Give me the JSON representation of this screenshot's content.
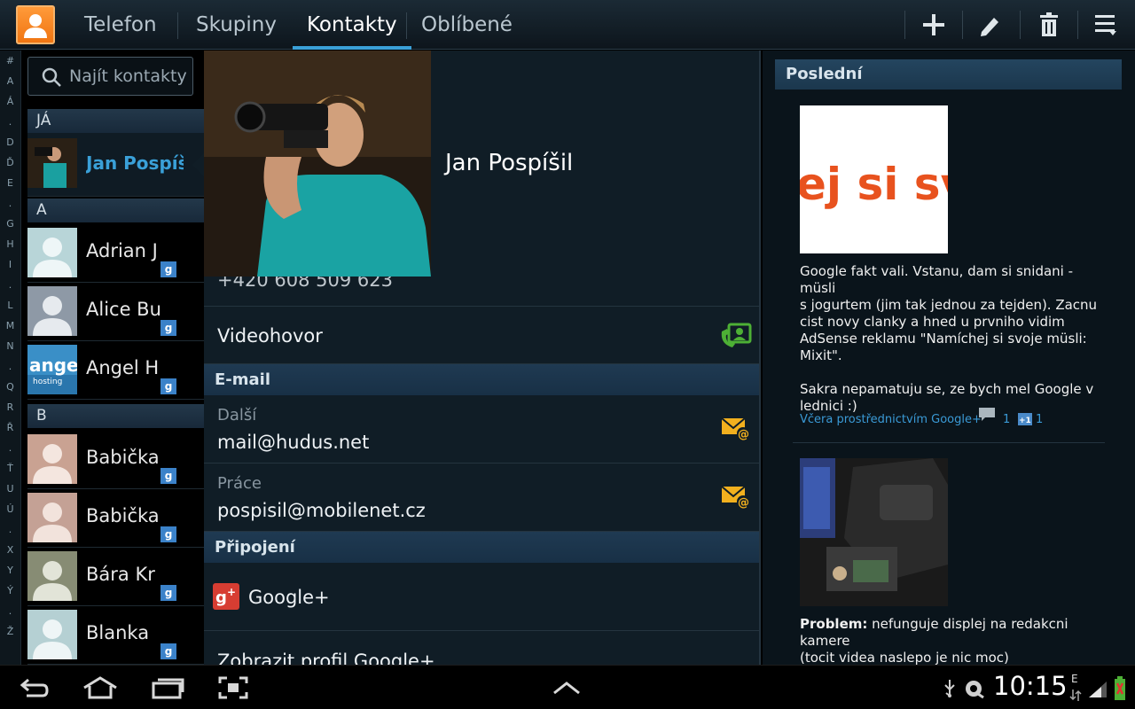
{
  "topbar": {
    "tabs": [
      "Telefon",
      "Skupiny",
      "Kontakty",
      "Oblíbené"
    ],
    "active_tab": "Kontakty"
  },
  "index_letters": [
    "#",
    "A",
    "Á",
    ".",
    "D",
    "Ď",
    "E",
    ".",
    "G",
    "H",
    "I",
    ".",
    "L",
    "M",
    "N",
    ".",
    "Q",
    "R",
    "Ř",
    ".",
    "Ť",
    "U",
    "Ú",
    ".",
    "X",
    "Y",
    "Ý",
    ".",
    "Ž"
  ],
  "contacts": {
    "search_placeholder": "Najít kontakty",
    "sections": [
      {
        "header": "JÁ",
        "items": [
          {
            "name": "Jan Pospíšil",
            "selected": true
          }
        ]
      },
      {
        "header": "A",
        "items": [
          {
            "name": "Adrian J"
          },
          {
            "name": "Alice Bu"
          },
          {
            "name": "Angel H"
          }
        ]
      },
      {
        "header": "B",
        "items": [
          {
            "name": "Babička"
          },
          {
            "name": "Babička"
          },
          {
            "name": "Bára Kr"
          },
          {
            "name": "Blanka"
          }
        ]
      }
    ],
    "google_badge": "g"
  },
  "detail": {
    "name": "Jan Pospíšil",
    "partial_phone": "+420 608 509 623",
    "videohovor": "Videohovor",
    "email_header": "E-mail",
    "emails": [
      {
        "label": "Další",
        "value": "mail@hudus.net"
      },
      {
        "label": "Práce",
        "value": "pospisil@mobilenet.cz"
      }
    ],
    "connections_header": "Připojení",
    "google_plus": "Google+",
    "view_profile": "Zobrazit profil Google+"
  },
  "recent": {
    "header": "Poslední",
    "posts": [
      {
        "image_text": "ej si sv",
        "text_lines": [
          "Google fakt vali. Vstanu, dam si snidani - müsli",
          "s jogurtem (jim tak jednou za tejden). Zacnu",
          "cist novy clanky a hned u prvniho vidim",
          "AdSense reklamu \"Namíchej si svoje müsli:",
          "Mixit\".",
          "",
          "Sakra nepamatuju se, ze bych mel Google v",
          "lednici :)"
        ],
        "meta": "Včera prostřednictvím Google+",
        "comments": "1",
        "plusones": "1"
      },
      {
        "bold": "Problem:",
        "text_lines": [
          " nefunguje displej na redakcni kamere",
          "(tocit videa naslepo je nic moc)"
        ]
      }
    ]
  },
  "system": {
    "time": "10:15",
    "network": "E"
  },
  "colors": {
    "accent": "#3aa0d8",
    "section": "#1f3a52",
    "mail_icon": "#f2b01e",
    "video_icon": "#4db035"
  }
}
